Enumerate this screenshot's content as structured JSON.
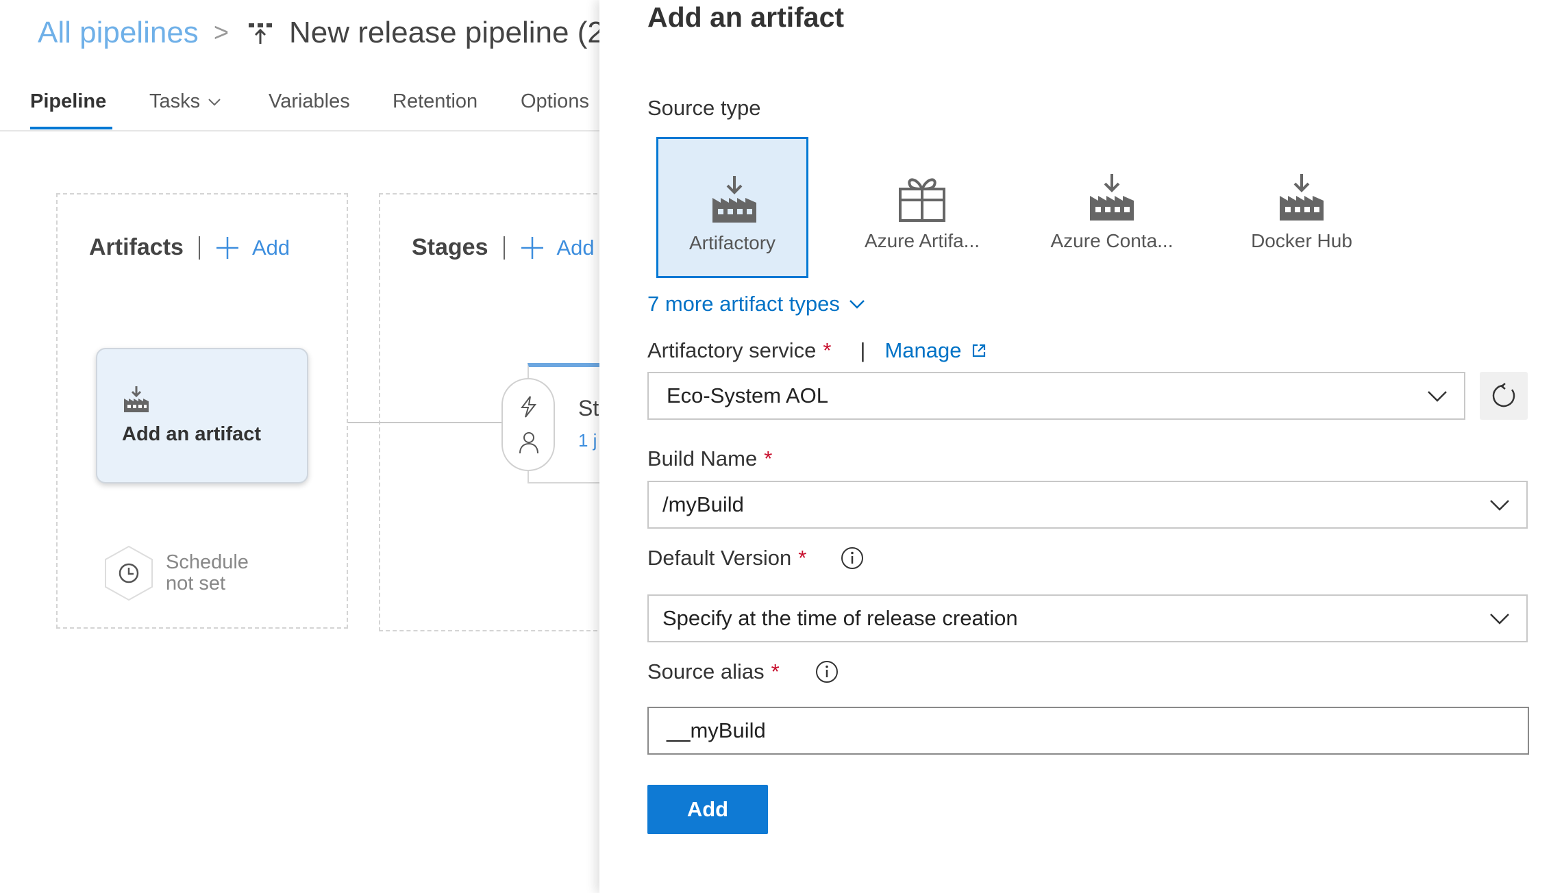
{
  "breadcrumb": {
    "root": "All pipelines",
    "separator": ">",
    "title": "New release pipeline (2)"
  },
  "tabs": [
    {
      "label": "Pipeline",
      "active": true
    },
    {
      "label": "Tasks",
      "has_dropdown": true
    },
    {
      "label": "Variables"
    },
    {
      "label": "Retention"
    },
    {
      "label": "Options"
    }
  ],
  "artifacts_section": {
    "title": "Artifacts",
    "add_label": "Add",
    "card_label": "Add an artifact",
    "schedule_line1": "Schedule",
    "schedule_line2": "not set"
  },
  "stages_section": {
    "title": "Stages",
    "add_label": "Add",
    "stage_name": "St",
    "stage_jobs": "1 j"
  },
  "panel": {
    "title": "Add an artifact",
    "source_type_label": "Source type",
    "source_types": [
      {
        "name": "Artifactory",
        "icon": "artifact-download-icon",
        "selected": true
      },
      {
        "name": "Azure Artifa...",
        "icon": "gift-package-icon"
      },
      {
        "name": "Azure Conta...",
        "icon": "artifact-download-icon"
      },
      {
        "name": "Docker Hub",
        "icon": "artifact-download-icon"
      }
    ],
    "more_types_label": "7 more artifact types",
    "artifactory_service": {
      "label": "Artifactory service",
      "required_mark": "*",
      "separator": "|",
      "manage_label": "Manage",
      "value": "Eco-System AOL"
    },
    "build_name": {
      "label": "Build Name",
      "required_mark": "*",
      "value": "/myBuild"
    },
    "default_version": {
      "label": "Default Version",
      "required_mark": "*",
      "value": "Specify at the time of release creation"
    },
    "source_alias": {
      "label": "Source alias",
      "required_mark": "*",
      "value": "__myBuild"
    },
    "add_button_label": "Add"
  },
  "colors": {
    "accent": "#0078d4",
    "link": "#0072c6",
    "required": "#c8102e",
    "selected_tile_bg": "#deecf9"
  }
}
